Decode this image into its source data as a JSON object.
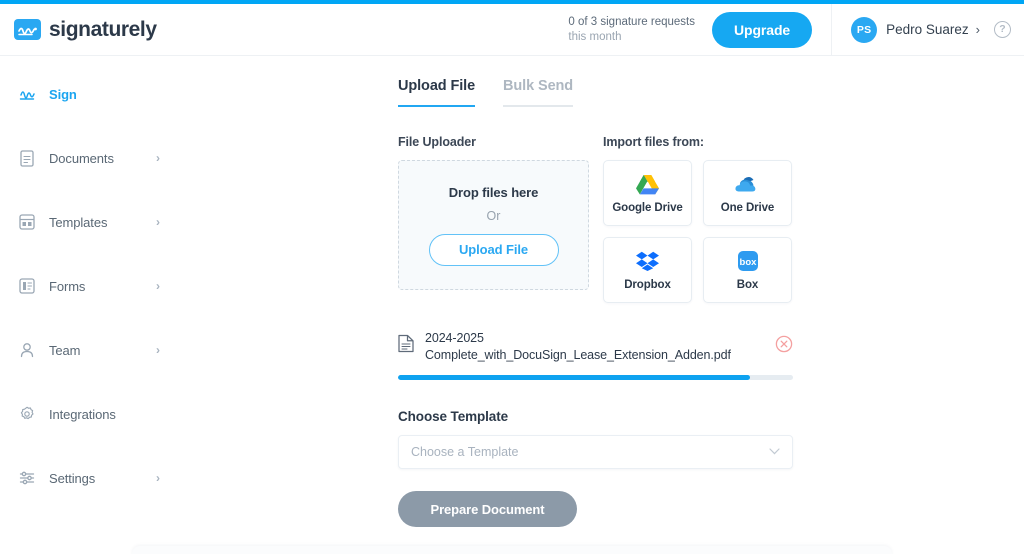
{
  "brand": {
    "name": "signaturely",
    "logo_icon": "signature-logo-icon",
    "accent": "#2aa8f2"
  },
  "header": {
    "quota_line1": "0 of 3 signature requests",
    "quota_line2": "this month",
    "upgrade_label": "Upgrade",
    "user": {
      "initials": "PS",
      "name": "Pedro Suarez",
      "chevron": "›"
    },
    "help_label": "?"
  },
  "sidebar": {
    "items": [
      {
        "label": "Sign",
        "icon": "signature-icon",
        "active": true,
        "chevron": ""
      },
      {
        "label": "Documents",
        "icon": "document-icon",
        "active": false,
        "chevron": "›"
      },
      {
        "label": "Templates",
        "icon": "template-icon",
        "active": false,
        "chevron": "›"
      },
      {
        "label": "Forms",
        "icon": "form-icon",
        "active": false,
        "chevron": "›"
      },
      {
        "label": "Team",
        "icon": "user-icon",
        "active": false,
        "chevron": "›"
      },
      {
        "label": "Integrations",
        "icon": "gear-icon",
        "active": false,
        "chevron": ""
      },
      {
        "label": "Settings",
        "icon": "sliders-icon",
        "active": false,
        "chevron": "›"
      }
    ]
  },
  "main": {
    "tabs": [
      {
        "label": "Upload File",
        "active": true
      },
      {
        "label": "Bulk Send",
        "active": false
      }
    ],
    "uploader": {
      "section_label": "File Uploader",
      "drop_title": "Drop files here",
      "or_label": "Or",
      "upload_button": "Upload File"
    },
    "import": {
      "section_label": "Import files from:",
      "sources": [
        {
          "label": "Google Drive",
          "icon": "google-drive-icon"
        },
        {
          "label": "One Drive",
          "icon": "one-drive-icon"
        },
        {
          "label": "Dropbox",
          "icon": "dropbox-icon"
        },
        {
          "label": "Box",
          "icon": "box-icon"
        }
      ]
    },
    "file": {
      "name_line1": "2024-2025",
      "name_line2": "Complete_with_DocuSign_Lease_Extension_Adden.pdf",
      "progress_percent": 89,
      "progress_color": "#0ea2f0",
      "remove_label": "remove file"
    },
    "template": {
      "title": "Choose Template",
      "placeholder": "Choose a Template",
      "selected_value": "",
      "chevron": "⌄"
    },
    "prepare_button": "Prepare Document"
  }
}
